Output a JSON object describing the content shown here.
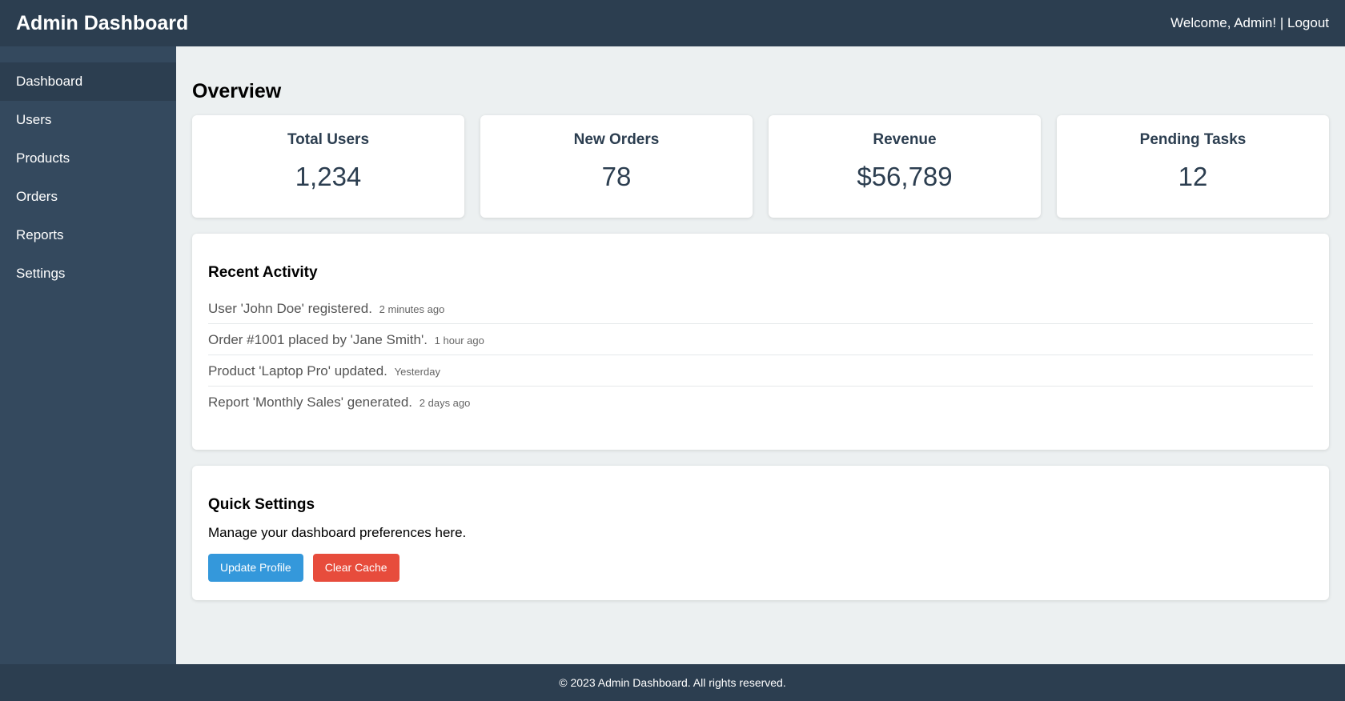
{
  "header": {
    "title": "Admin Dashboard",
    "welcome": "Welcome, Admin!",
    "separator": " | ",
    "logout": "Logout"
  },
  "sidebar": {
    "items": [
      {
        "label": "Dashboard",
        "active": true
      },
      {
        "label": "Users"
      },
      {
        "label": "Products"
      },
      {
        "label": "Orders"
      },
      {
        "label": "Reports"
      },
      {
        "label": "Settings"
      }
    ]
  },
  "main": {
    "title": "Overview",
    "cards": [
      {
        "label": "Total Users",
        "value": "1,234"
      },
      {
        "label": "New Orders",
        "value": "78"
      },
      {
        "label": "Revenue",
        "value": "$56,789"
      },
      {
        "label": "Pending Tasks",
        "value": "12"
      }
    ],
    "activity": {
      "title": "Recent Activity",
      "items": [
        {
          "text": "User 'John Doe' registered.",
          "time": "2 minutes ago"
        },
        {
          "text": "Order #1001 placed by 'Jane Smith'.",
          "time": "1 hour ago"
        },
        {
          "text": "Product 'Laptop Pro' updated.",
          "time": "Yesterday"
        },
        {
          "text": "Report 'Monthly Sales' generated.",
          "time": "2 days ago"
        }
      ]
    },
    "settings": {
      "title": "Quick Settings",
      "description": "Manage your dashboard preferences here.",
      "update_label": "Update Profile",
      "clear_label": "Clear Cache"
    }
  },
  "footer": {
    "text": "© 2023 Admin Dashboard. All rights reserved."
  },
  "colors": {
    "header_bg": "#2c3e50",
    "sidebar_bg": "#34495e",
    "primary_button": "#3498db",
    "danger_button": "#e74c3c"
  }
}
